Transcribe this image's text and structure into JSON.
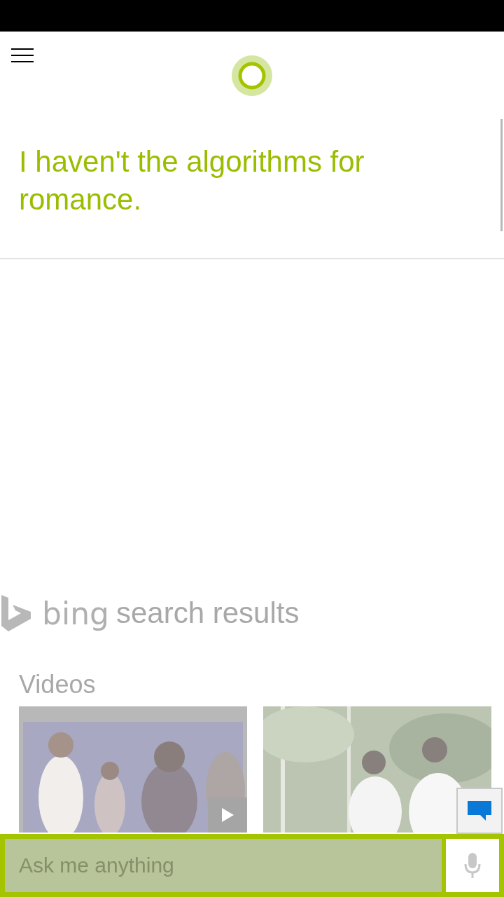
{
  "response": {
    "text": "I haven't the algorithms for romance."
  },
  "bing_header": {
    "logo": "bing",
    "title": "search results"
  },
  "videos": {
    "heading": "Videos",
    "items": [
      {
        "kind": "picture",
        "play_badge": true
      },
      {
        "kind": "picture"
      }
    ]
  },
  "search": {
    "placeholder": "Ask me anything"
  }
}
